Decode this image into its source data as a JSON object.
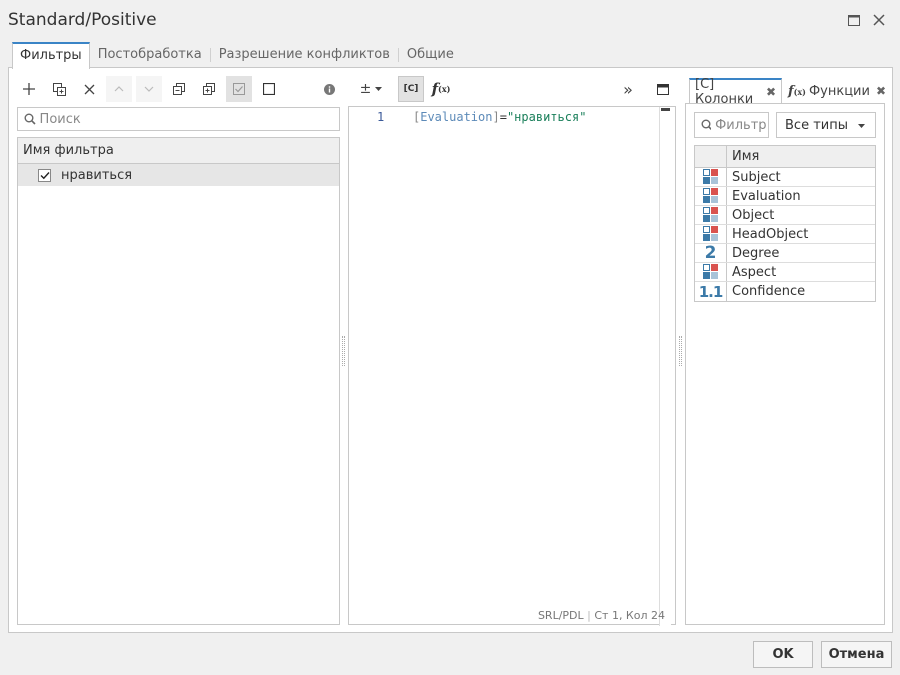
{
  "window": {
    "title": "Standard/Positive"
  },
  "tabs": [
    "Фильтры",
    "Постобработка",
    "Разрешение конфликтов",
    "Общие"
  ],
  "left": {
    "search_placeholder": "Поиск",
    "column_header": "Имя фильтра",
    "filters": [
      {
        "name": "нравиться",
        "checked": true
      }
    ]
  },
  "editor": {
    "line_number": "1",
    "code": {
      "open": "[",
      "field": "Evaluation",
      "close": "]",
      "op": "=",
      "value": "\"нравиться\""
    },
    "status_lang": "SRL/PDL",
    "status_pos": "Ст 1, Кол 24",
    "columns_btn": "[C]"
  },
  "right": {
    "tab_columns": "[C] Колонки",
    "tab_functions": "Функции",
    "filter_placeholder": "Фильтр",
    "type_select": "Все типы",
    "name_header": "Имя",
    "columns": [
      {
        "name": "Subject",
        "icon": "category"
      },
      {
        "name": "Evaluation",
        "icon": "category"
      },
      {
        "name": "Object",
        "icon": "category"
      },
      {
        "name": "HeadObject",
        "icon": "category"
      },
      {
        "name": "Degree",
        "icon": "integer",
        "glyph": "2"
      },
      {
        "name": "Aspect",
        "icon": "category"
      },
      {
        "name": "Confidence",
        "icon": "decimal",
        "glyph": "1.1"
      }
    ]
  },
  "footer": {
    "ok": "OK",
    "cancel": "Отмена"
  },
  "colors": {
    "accent": "#3a84c6",
    "icon_red": "#d9534f",
    "icon_blue": "#3c7aa8"
  }
}
